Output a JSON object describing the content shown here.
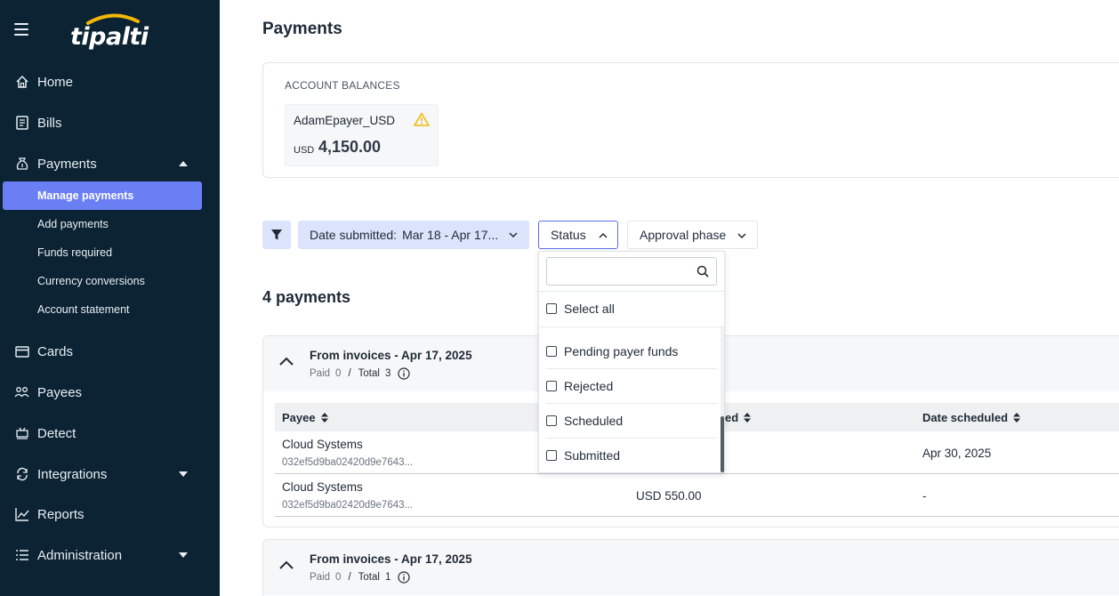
{
  "app": {
    "logo_text": "tipalti"
  },
  "sidebar": {
    "items": [
      {
        "label": "Home",
        "icon": "home-icon"
      },
      {
        "label": "Bills",
        "icon": "bills-icon"
      },
      {
        "label": "Payments",
        "icon": "money-bag-icon",
        "expanded": true
      },
      {
        "label": "Cards",
        "icon": "card-icon"
      },
      {
        "label": "Payees",
        "icon": "people-icon"
      },
      {
        "label": "Detect",
        "icon": "detect-icon"
      },
      {
        "label": "Integrations",
        "icon": "sync-icon"
      },
      {
        "label": "Reports",
        "icon": "chart-icon"
      },
      {
        "label": "Administration",
        "icon": "list-icon"
      }
    ],
    "payments_sub": [
      {
        "label": "Manage payments",
        "active": true
      },
      {
        "label": "Add payments"
      },
      {
        "label": "Funds required"
      },
      {
        "label": "Currency conversions"
      },
      {
        "label": "Account statement"
      }
    ]
  },
  "page": {
    "title": "Payments"
  },
  "balances": {
    "heading": "ACCOUNT BALANCES",
    "account_name": "AdamEpayer_USD",
    "currency": "USD",
    "amount": "4,150.00"
  },
  "filters": {
    "date_label": "Date submitted:",
    "date_value": "Mar 18 - Apr 17...",
    "status_label": "Status",
    "approval_label": "Approval phase"
  },
  "status_dropdown": {
    "search_placeholder": "",
    "select_all": "Select all",
    "options": [
      "Pending payer funds",
      "Rejected",
      "Scheduled",
      "Submitted"
    ]
  },
  "payments": {
    "count_label": "4 payments",
    "groups": [
      {
        "title": "From invoices - Apr 17, 2025",
        "paid_label": "Paid",
        "paid": "0",
        "total_label": "Total",
        "total": "3",
        "columns": {
          "payee": "Payee",
          "submitted": "ed",
          "scheduled": "Date scheduled"
        },
        "rows": [
          {
            "payee": "Cloud Systems",
            "id": "032ef5d9ba02420d9e7643...",
            "amount": "",
            "date": "Apr 30, 2025"
          },
          {
            "payee": "Cloud Systems",
            "id": "032ef5d9ba02420d9e7643...",
            "amount": "USD 550.00",
            "date": "-"
          }
        ]
      },
      {
        "title": "From invoices - Apr 17, 2025",
        "paid_label": "Paid",
        "paid": "0",
        "total_label": "Total",
        "total": "1"
      }
    ]
  },
  "colors": {
    "sidebar_bg": "#0c2333",
    "accent": "#6b7ff5",
    "chip_bg": "#dbe4fb",
    "warning": "#f2b705"
  }
}
